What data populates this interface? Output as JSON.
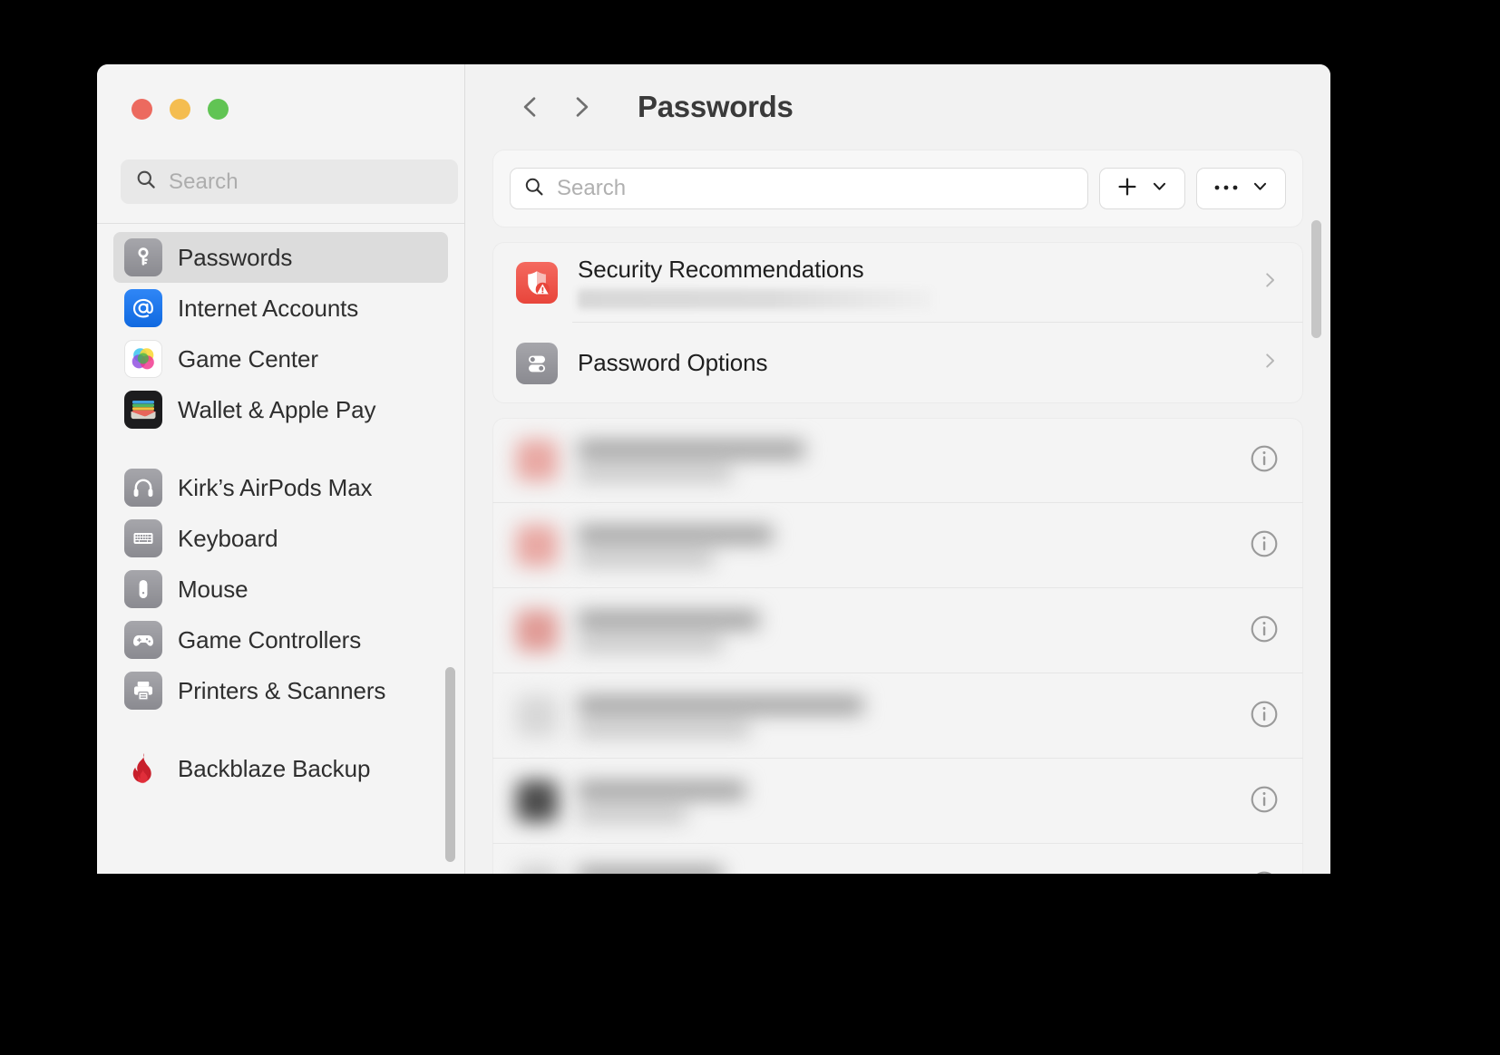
{
  "window": {
    "traffic_lights": [
      {
        "name": "close",
        "color": "#ec6a5f"
      },
      {
        "name": "minimize",
        "color": "#f4bd50"
      },
      {
        "name": "zoom",
        "color": "#61c454"
      }
    ]
  },
  "sidebar": {
    "search": {
      "placeholder": "Search",
      "value": "",
      "icon": "search-icon"
    },
    "groups": [
      {
        "items": [
          {
            "label": "Passwords",
            "icon": "key-icon",
            "icon_style": "ic-gray",
            "selected": true
          },
          {
            "label": "Internet Accounts",
            "icon": "at-sign-icon",
            "icon_style": "ic-blue",
            "selected": false
          },
          {
            "label": "Game Center",
            "icon": "game-center-icon",
            "icon_style": "ic-white",
            "selected": false
          },
          {
            "label": "Wallet & Apple Pay",
            "icon": "wallet-icon",
            "icon_style": "ic-black",
            "selected": false
          }
        ]
      },
      {
        "items": [
          {
            "label": "Kirk’s AirPods Max",
            "icon": "headphones-icon",
            "icon_style": "ic-gray",
            "selected": false
          },
          {
            "label": "Keyboard",
            "icon": "keyboard-icon",
            "icon_style": "ic-gray",
            "selected": false
          },
          {
            "label": "Mouse",
            "icon": "mouse-icon",
            "icon_style": "ic-gray",
            "selected": false
          },
          {
            "label": "Game Controllers",
            "icon": "gamepad-icon",
            "icon_style": "ic-gray",
            "selected": false
          },
          {
            "label": "Printers & Scanners",
            "icon": "printer-icon",
            "icon_style": "ic-gray",
            "selected": false
          }
        ]
      },
      {
        "items": [
          {
            "label": "Backblaze Backup",
            "icon": "backblaze-flame-icon",
            "icon_style": "ic-plain",
            "selected": false
          }
        ]
      }
    ]
  },
  "header": {
    "back_icon": "chevron-left-icon",
    "forward_icon": "chevron-right-icon",
    "title": "Passwords"
  },
  "toolbar": {
    "search": {
      "placeholder": "Search",
      "value": "",
      "icon": "search-icon"
    },
    "add_button": {
      "icon": "plus-icon",
      "menu_icon": "chevron-down-icon"
    },
    "more_button": {
      "icon": "ellipsis-icon",
      "menu_icon": "chevron-down-icon"
    }
  },
  "options_card": {
    "rows": [
      {
        "title": "Security Recommendations",
        "icon": "shield-warning-icon",
        "icon_style": "ic-red",
        "has_blurred_subtitle": true,
        "chevron": "chevron-right-icon"
      },
      {
        "title": "Password Options",
        "icon": "toggles-icon",
        "icon_style": "ic-gray",
        "has_blurred_subtitle": false,
        "chevron": "chevron-right-icon"
      }
    ]
  },
  "password_list": {
    "redacted": true,
    "rows": [
      {
        "favicon_color": "#e8a7a2",
        "title_width": 250,
        "sub_width": 170,
        "info_icon": "info-icon"
      },
      {
        "favicon_color": "#e8a7a2",
        "title_width": 215,
        "sub_width": 150,
        "info_icon": "info-icon"
      },
      {
        "favicon_color": "#e09a95",
        "title_width": 200,
        "sub_width": 160,
        "info_icon": "info-icon"
      },
      {
        "favicon_color": "#d7d7d7",
        "title_width": 315,
        "sub_width": 190,
        "info_icon": "info-icon"
      },
      {
        "favicon_color": "#4a4a4a",
        "title_width": 185,
        "sub_width": 120,
        "info_icon": "info-icon"
      },
      {
        "favicon_color": "#cfcfcf",
        "title_width": 160,
        "sub_width": 110,
        "info_icon": "info-icon"
      }
    ]
  },
  "colors": {
    "window_bg": "#f2f2f2",
    "sidebar_bg": "#f4f4f4",
    "selected_row": "#dcdcdc",
    "accent_red": "#e8453b",
    "text_primary": "#1e1e1e"
  }
}
